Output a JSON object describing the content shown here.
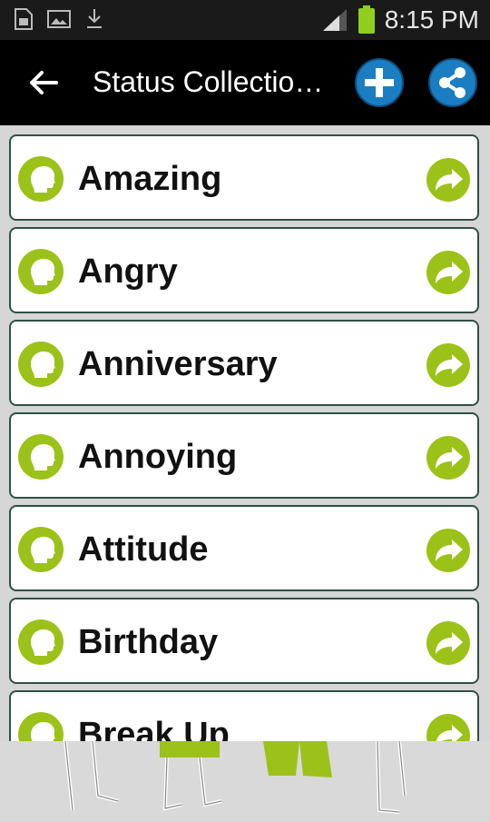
{
  "status_bar": {
    "time": "8:15 PM",
    "icons": [
      "sim-card-icon",
      "image-icon",
      "download-icon",
      "signal-icon",
      "battery-icon"
    ]
  },
  "action_bar": {
    "title": "Status Collectio…",
    "back_icon": "back-arrow-icon",
    "add_icon": "plus-icon",
    "share_icon": "share-icon"
  },
  "colors": {
    "accent_green": "#9cc21a",
    "action_blue": "#1b7ec2",
    "bar_black": "#000000"
  },
  "categories": [
    {
      "label": "Amazing"
    },
    {
      "label": "Angry"
    },
    {
      "label": "Anniversary"
    },
    {
      "label": "Annoying"
    },
    {
      "label": "Attitude"
    },
    {
      "label": "Birthday"
    },
    {
      "label": "Break Up"
    }
  ]
}
